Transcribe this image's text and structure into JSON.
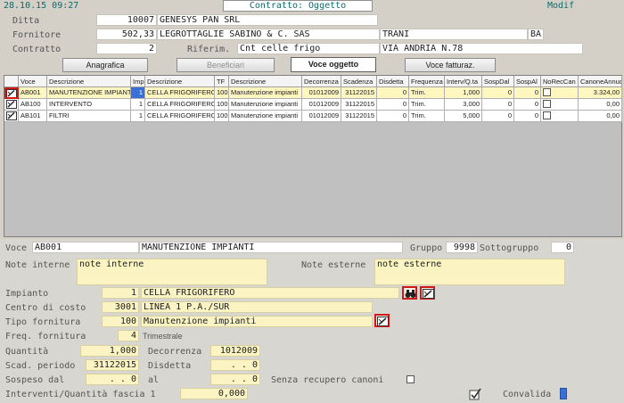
{
  "header": {
    "timestamp": "28.10.15 09:27",
    "title": "Contratto: Oggetto",
    "mode": "Modif"
  },
  "contract": {
    "ditta_label": "Ditta",
    "ditta_code": "10007",
    "ditta_name": "GENESYS PAN SRL",
    "fornitore_label": "Fornitore",
    "fornitore_code": "502,33",
    "fornitore_name": "LEGROTTAGLIE SABINO & C. SAS",
    "fornitore_city": "TRANI",
    "fornitore_prov": "BA",
    "contratto_label": "Contratto",
    "contratto_num": "2",
    "riferim_label": "Riferim.",
    "riferim_value": "Cnt celle frigo",
    "address": "VIA ANDRIA N.78"
  },
  "buttons": {
    "anagrafica": "Anagrafica",
    "beneficiari": "Beneficiari",
    "voce_oggetto": "Voce oggetto",
    "voce_fatturaz": "Voce fatturaz."
  },
  "grid": {
    "columns": [
      "Voce",
      "Descrizione",
      "Imp",
      "Descrizione",
      "TF",
      "Descrizione",
      "Decorrenza",
      "Scadenza",
      "Disdetta",
      "Frequenza",
      "Interv/Q.ta",
      "SospDal",
      "SospAl",
      "NoRecCan",
      "CanoneAnnuo"
    ],
    "rows": [
      {
        "voce": "AB001",
        "desc": "MANUTENZIONE IMPIANTI",
        "imp": "1",
        "imp_desc": "CELLA FRIGORIFERO",
        "tf": "100",
        "tf_desc": "Manutenzione impianti",
        "decorrenza": "01012009",
        "scadenza": "31122015",
        "disdetta": "0",
        "frequenza": "Trim.",
        "interv": "1,000",
        "sospdal": "0",
        "sospal": "0",
        "canone": "3.324,00"
      },
      {
        "voce": "AB100",
        "desc": "INTERVENTO",
        "imp": "1",
        "imp_desc": "CELLA FRIGORIFERO",
        "tf": "100",
        "tf_desc": "Manutenzione impianti",
        "decorrenza": "01012009",
        "scadenza": "31122015",
        "disdetta": "0",
        "frequenza": "Trim.",
        "interv": "3,000",
        "sospdal": "0",
        "sospal": "0",
        "canone": "0,00"
      },
      {
        "voce": "AB101",
        "desc": "FILTRI",
        "imp": "1",
        "imp_desc": "CELLA FRIGORIFERO",
        "tf": "100",
        "tf_desc": "Manutenzione impianti",
        "decorrenza": "01012009",
        "scadenza": "31122015",
        "disdetta": "0",
        "frequenza": "Trim.",
        "interv": "5,000",
        "sospdal": "0",
        "sospal": "0",
        "canone": "0,00"
      }
    ]
  },
  "detail": {
    "voce_label": "Voce",
    "voce_code": "AB001",
    "voce_desc": "MANUTENZIONE IMPIANTI",
    "gruppo_label": "Gruppo",
    "gruppo_value": "9998",
    "sottogruppo_label": "Sottogruppo",
    "sottogruppo_value": "0",
    "note_interne_label": "Note interne",
    "note_interne": "note interne",
    "note_esterne_label": "Note esterne",
    "note_esterne": "note esterne",
    "impianto_label": "Impianto",
    "impianto_code": "1",
    "impianto_desc": "CELLA FRIGORIFERO",
    "centro_label": "Centro di costo",
    "centro_code": "3001",
    "centro_desc": "LINEA 1 P.A./SUR",
    "tipo_label": "Tipo fornitura",
    "tipo_code": "100",
    "tipo_desc": "Manutenzione impianti",
    "freq_label": "Freq. fornitura",
    "freq_code": "4",
    "freq_desc": "Trimestrale",
    "quantita_label": "Quantità",
    "quantita": "1,000",
    "decorrenza_label": "Decorrenza",
    "decorrenza": "1012009",
    "scad_label": "Scad. periodo",
    "scad": "31122015",
    "disdetta_label": "Disdetta",
    "disdetta": ". .  0",
    "sospeso_label": "Sospeso dal",
    "sospeso": ". .  0",
    "al_label": "al",
    "al": ". .  0",
    "senza_label": "Senza recupero canoni",
    "interventi_label": "Interventi/Quantità fascia 1",
    "interventi": "0,000",
    "convalida_label": "Convalida"
  }
}
